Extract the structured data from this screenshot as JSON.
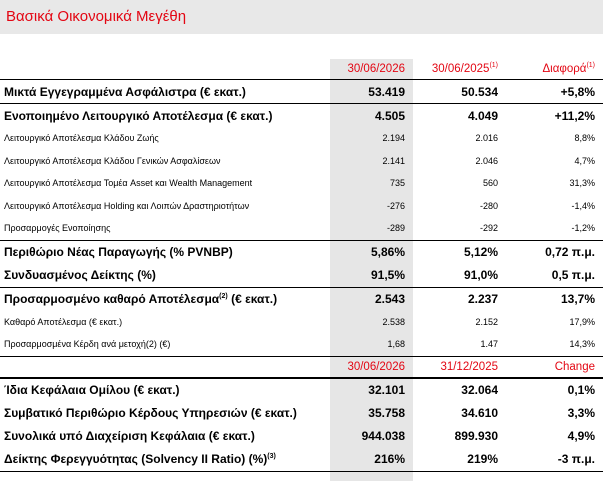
{
  "title": "Βασικά Οικονομικά Μεγέθη",
  "colors": {
    "accent": "#e30613",
    "shade": "#e6e6e6",
    "title_bg": "#e8e8e8"
  },
  "header1": {
    "c1": "30/06/2026",
    "c2": "30/06/2025",
    "c2_sup": "(1)",
    "c3": "Διαφορά",
    "c3_sup": "(1)"
  },
  "rows1": [
    {
      "label": "Μικτά Εγγεγραμμένα Ασφάλιστρα (€ εκατ.)",
      "v1": "53.419",
      "v2": "50.534",
      "v3": "+5,8%"
    },
    {
      "label": "Ενοποιημένο Λειτουργικό Αποτέλεσμα (€ εκατ.)",
      "v1": "4.505",
      "v2": "4.049",
      "v3": "+11,2%"
    },
    {
      "label": "Λειτουργικό Αποτέλεσμα Κλάδου Ζωής",
      "v1": "2.194",
      "v2": "2.016",
      "v3": "8,8%"
    },
    {
      "label": "Λειτουργικό Αποτέλεσμα Κλάδου Γενικών Ασφαλίσεων",
      "v1": "2.141",
      "v2": "2.046",
      "v3": "4,7%"
    },
    {
      "label": "Λειτουργικό Αποτέλεσμα Τομέα Asset και Wealth Management",
      "v1": "735",
      "v2": "560",
      "v3": "31,3%"
    },
    {
      "label": "Λειτουργικό Αποτέλεσμα Holding και Λοιπών Δραστηριοτήτων",
      "v1": "-276",
      "v2": "-280",
      "v3": "-1,4%"
    },
    {
      "label": "Προσαρμογές Ενοποίησης",
      "v1": "-289",
      "v2": "-292",
      "v3": "-1,2%"
    },
    {
      "label": "Περιθώριο Νέας Παραγωγής (% PVNBP)",
      "v1": "5,86%",
      "v2": "5,12%",
      "v3": "0,72 π.μ."
    },
    {
      "label": "Συνδυασμένος Δείκτης (%)",
      "v1": "91,5%",
      "v2": "91,0%",
      "v3": "0,5 π.μ."
    },
    {
      "label_a": "Προσαρμοσμένο καθαρό Αποτέλεσμα",
      "label_sup": "(2)",
      "label_b": " (€ εκατ.)",
      "v1": "2.543",
      "v2": "2.237",
      "v3": "13,7%"
    },
    {
      "label": "Καθαρό Αποτέλεσμα (€ εκατ.)",
      "v1": "2.538",
      "v2": "2.152",
      "v3": "17,9%"
    },
    {
      "label": "Προσαρμοσμένα Κέρδη ανά μετοχή(2) (€)",
      "v1": "1,68",
      "v2": "1.47",
      "v3": "14,3%"
    }
  ],
  "header2": {
    "c1": "30/06/2026",
    "c2": "31/12/2025",
    "c3": "Change"
  },
  "rows2": [
    {
      "label": "Ίδια Κεφάλαια Ομίλου (€ εκατ.)",
      "v1": "32.101",
      "v2": "32.064",
      "v3": "0,1%"
    },
    {
      "label": "Συμβατικό Περιθώριο Κέρδους Υπηρεσιών (€ εκατ.)",
      "v1": "35.758",
      "v2": "34.610",
      "v3": "3,3%"
    },
    {
      "label": "Συνολικά υπό Διαχείριση Κεφάλαια (€ εκατ.)",
      "v1": "944.038",
      "v2": "899.930",
      "v3": "4,9%"
    },
    {
      "label_a": "Δείκτης Φερεγγυότητας (Solvency II Ratio) (%)",
      "label_sup": "(3)",
      "v1": "216%",
      "v2": "219%",
      "v3": "-3 π.μ."
    }
  ]
}
